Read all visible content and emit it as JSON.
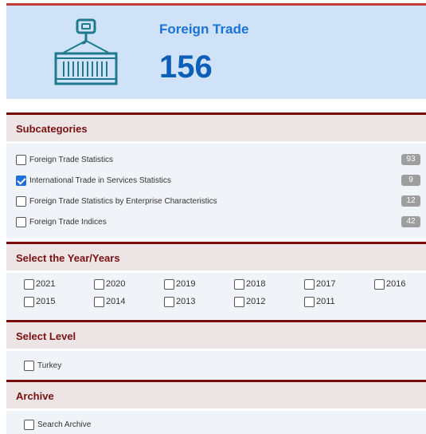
{
  "hero": {
    "title": "Foreign Trade",
    "count": "156",
    "icon": "container-crane-icon",
    "accent_color": "#1a73d9",
    "background_color": "#cfe2f7"
  },
  "subcategories": {
    "heading": "Subcategories",
    "items": [
      {
        "label": "Foreign Trade Statistics",
        "count": "93",
        "checked": false
      },
      {
        "label": "International Trade in Services Statistics",
        "count": "9",
        "checked": true
      },
      {
        "label": "Foreign Trade Statistics by Enterprise Characteristics",
        "count": "12",
        "checked": false
      },
      {
        "label": "Foreign Trade Indices",
        "count": "42",
        "checked": false
      }
    ]
  },
  "years": {
    "heading": "Select the Year/Years",
    "items": [
      "2021",
      "2020",
      "2019",
      "2018",
      "2017",
      "2016",
      "2015",
      "2014",
      "2013",
      "2012",
      "2011"
    ]
  },
  "level": {
    "heading": "Select Level",
    "items": [
      {
        "label": "Turkey",
        "checked": false
      }
    ]
  },
  "archive": {
    "heading": "Archive",
    "items": [
      {
        "label": "Search Archive",
        "checked": false
      }
    ]
  },
  "colors": {
    "section_heading_text": "#7b1010",
    "section_border": "#7b0a0a",
    "checkbox_checked": "#1e6fd9",
    "badge": "#9e9e9e"
  }
}
